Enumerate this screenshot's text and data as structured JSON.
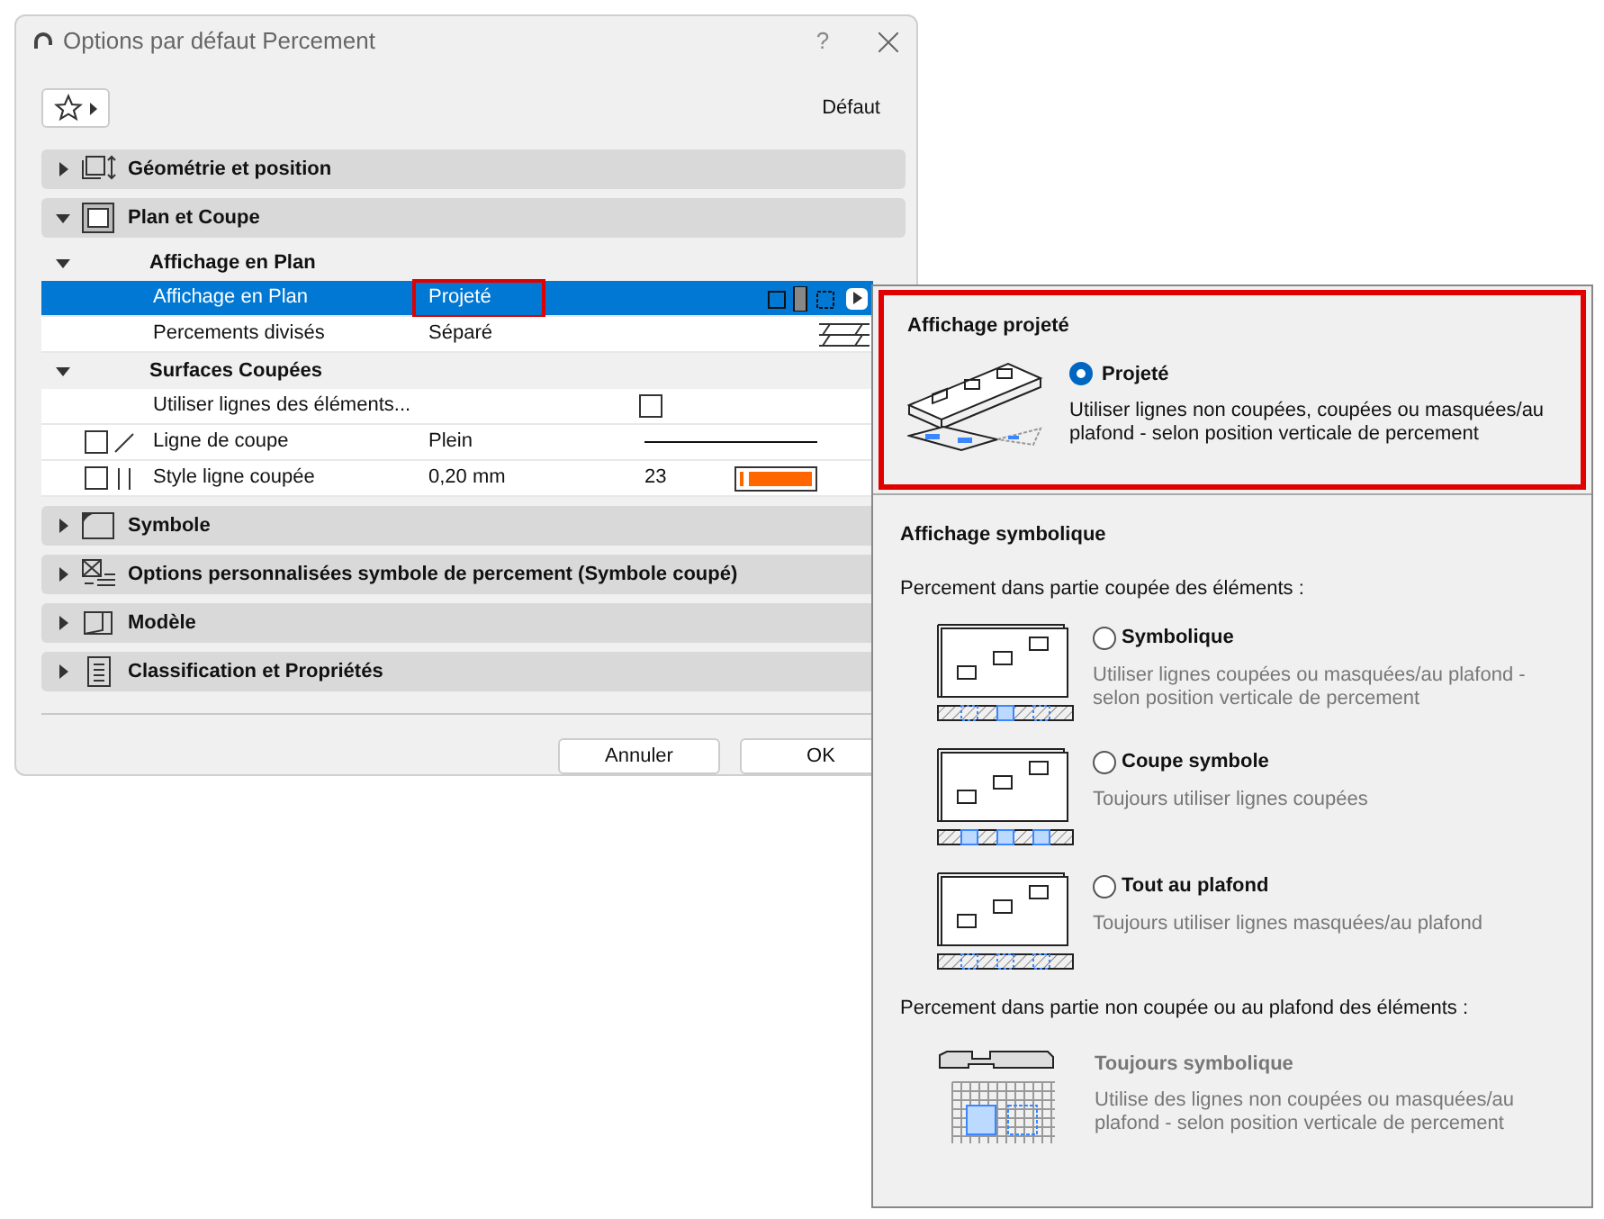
{
  "window": {
    "title": "Options par défaut Percement",
    "help": "?"
  },
  "favorites": {
    "label": "Défaut"
  },
  "sections": [
    {
      "title": "Géométrie et position",
      "expanded": false
    },
    {
      "title": "Plan et Coupe",
      "expanded": true,
      "groups": [
        {
          "title": "Affichage en Plan",
          "expanded": true,
          "rows": [
            {
              "kind": "choice",
              "label": "Affichage en Plan",
              "value": "Projeté",
              "selected": true,
              "highlighted": true
            },
            {
              "kind": "split",
              "label": "Percements divisés",
              "value": "Séparé",
              "selected": false,
              "highlighted": false
            }
          ]
        },
        {
          "title": "Surfaces Coupées",
          "expanded": true,
          "rows": [
            {
              "kind": "checkbox",
              "label": "Utiliser lignes des éléments...",
              "checked": false,
              "selected": false
            },
            {
              "kind": "line",
              "label": "Ligne de coupe",
              "value": "Plein",
              "checked": false,
              "selected": false
            },
            {
              "kind": "pen",
              "label": "Style ligne coupée",
              "value": "0,20 mm",
              "pen": "23",
              "checked": false,
              "selected": false,
              "color": "#ff6600"
            }
          ]
        }
      ]
    },
    {
      "title": "Symbole",
      "expanded": false
    },
    {
      "title": "Options personnalisées symbole de percement (Symbole coupé)",
      "expanded": false
    },
    {
      "title": "Modèle",
      "expanded": false
    },
    {
      "title": "Classification et Propriétés",
      "expanded": false
    }
  ],
  "buttons": [
    "Annuler",
    "OK"
  ],
  "popup": {
    "projected": {
      "title": "Affichage projeté",
      "highlighted": true,
      "option": {
        "label": "Projeté",
        "description": "Utiliser lignes non coupées, coupées ou masquées/au plafond - selon position verticale de percement",
        "selected": true
      }
    },
    "symbolic": {
      "title": "Affichage symbolique",
      "cut_label": "Percement dans partie coupée des éléments :",
      "options": [
        {
          "label": "Symbolique",
          "description": "Utiliser lignes coupées ou masquées/au plafond - selon position verticale de percement",
          "selected": false
        },
        {
          "label": "Coupe symbole",
          "description": "Toujours utiliser lignes coupées",
          "selected": false
        },
        {
          "label": "Tout au plafond",
          "description": "Toujours utiliser lignes masquées/au plafond",
          "selected": false
        }
      ],
      "uncut_label": "Percement dans partie non coupée ou au plafond des éléments :",
      "uncut_option": {
        "label": "Toujours symbolique",
        "description": "Utilise des lignes non coupées ou masquées/au plafond - selon position verticale de percement",
        "disabled": true
      }
    }
  }
}
